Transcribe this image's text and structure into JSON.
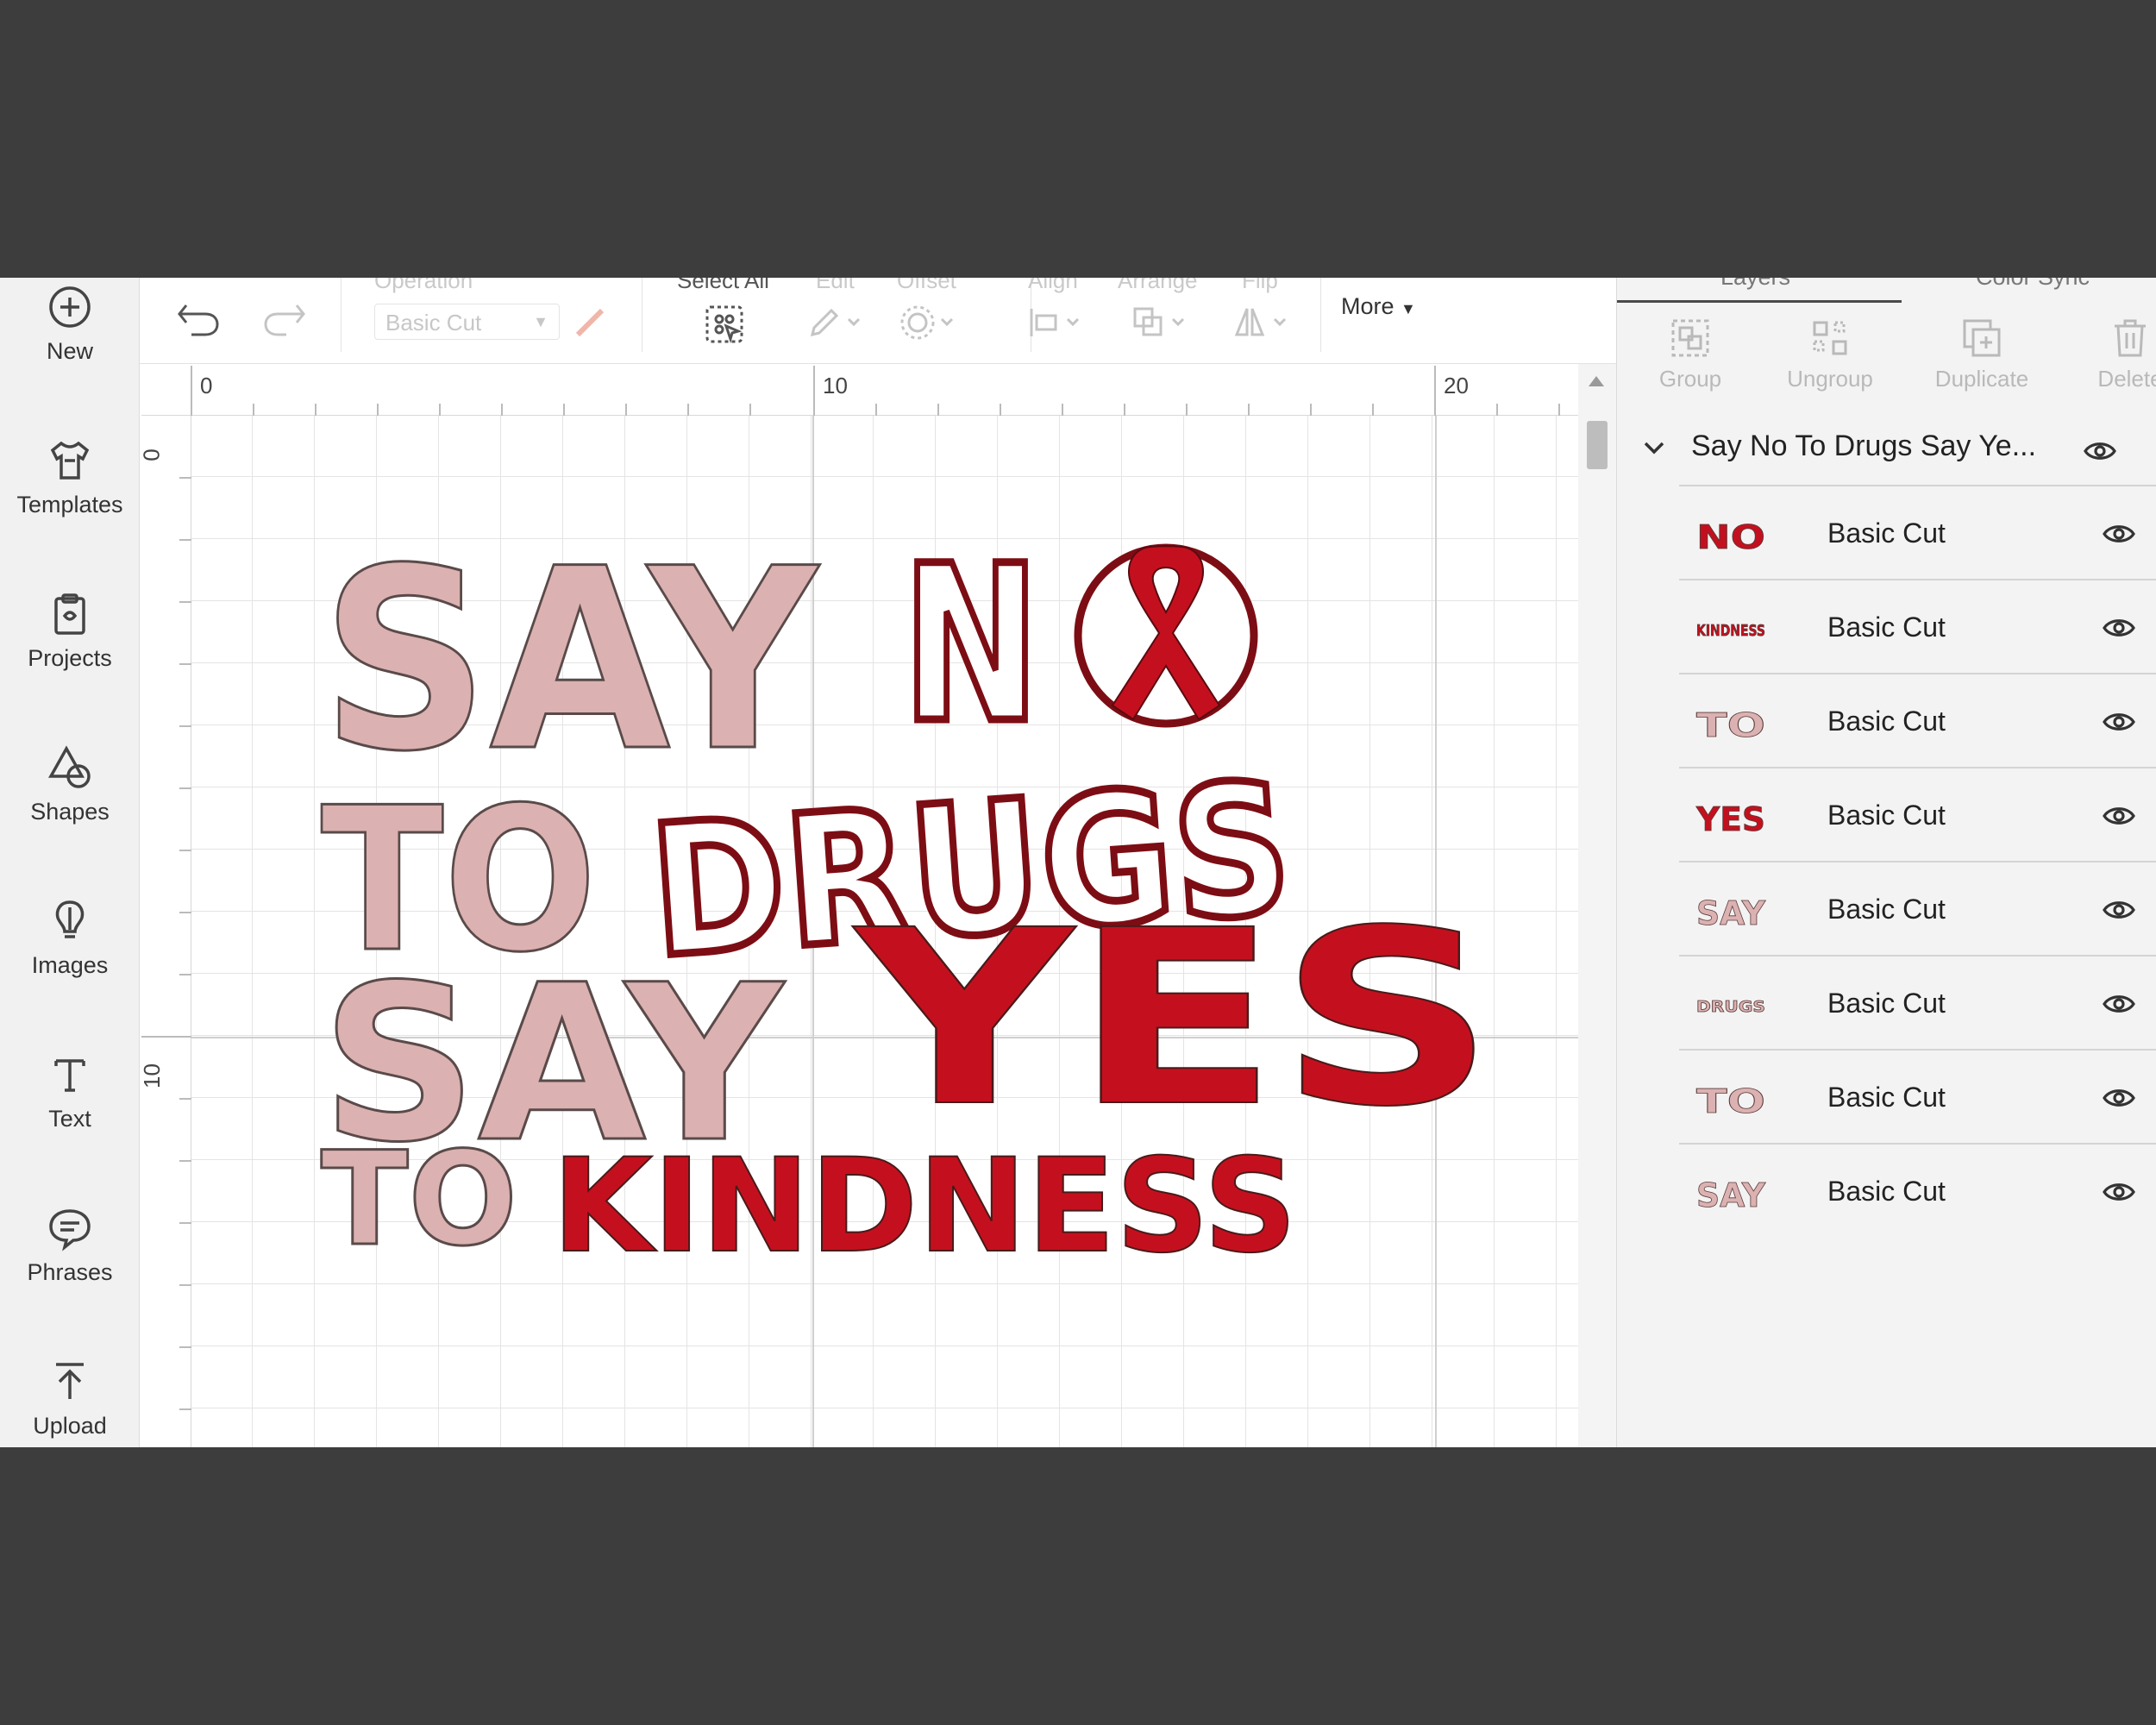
{
  "sidebar": {
    "items": [
      {
        "label": "New",
        "icon": "plus-circle-icon"
      },
      {
        "label": "Templates",
        "icon": "tshirt-icon"
      },
      {
        "label": "Projects",
        "icon": "clipboard-icon"
      },
      {
        "label": "Shapes",
        "icon": "shapes-icon"
      },
      {
        "label": "Images",
        "icon": "lightbulb-icon"
      },
      {
        "label": "Text",
        "icon": "text-icon"
      },
      {
        "label": "Phrases",
        "icon": "speech-bubble-icon"
      },
      {
        "label": "Upload",
        "icon": "upload-icon"
      }
    ]
  },
  "toolbar": {
    "operation_label": "Operation",
    "operation_value": "Basic Cut",
    "select_all_label": "Select All",
    "edit_label": "Edit",
    "offset_label": "Offset",
    "align_label": "Align",
    "arrange_label": "Arrange",
    "flip_label": "Flip",
    "more_label": "More"
  },
  "rulers": {
    "top": [
      "0",
      "10",
      "20"
    ],
    "left": [
      "0",
      "10"
    ]
  },
  "canvas": {
    "words": {
      "say1": "SAY",
      "no": "N",
      "to1": "TO",
      "drugs": "DRUGS",
      "say2": "SAY",
      "yes": "YES",
      "to2": "TO",
      "kindness": "KINDNESS"
    },
    "colors": {
      "pink": "#dbb2b1",
      "red": "#c4101e",
      "outline": "#7d0d14"
    }
  },
  "right_panel": {
    "tabs": [
      "Layers",
      "Color Sync"
    ],
    "actions": [
      {
        "label": "Group",
        "icon": "group-icon"
      },
      {
        "label": "Ungroup",
        "icon": "ungroup-icon"
      },
      {
        "label": "Duplicate",
        "icon": "duplicate-icon"
      },
      {
        "label": "Delete",
        "icon": "trash-icon"
      }
    ],
    "group_title": "Say No To Drugs Say Ye...",
    "layers": [
      {
        "thumb": "NO",
        "name": "Basic Cut",
        "color": "#c4101e"
      },
      {
        "thumb": "KINDNESS",
        "name": "Basic Cut",
        "color": "#c4101e"
      },
      {
        "thumb": "TO",
        "name": "Basic Cut",
        "color": "#dbb2b1"
      },
      {
        "thumb": "YES",
        "name": "Basic Cut",
        "color": "#c4101e"
      },
      {
        "thumb": "SAY",
        "name": "Basic Cut",
        "color": "#dbb2b1"
      },
      {
        "thumb": "DRUGS",
        "name": "Basic Cut",
        "color": "#dbb2b1"
      },
      {
        "thumb": "TO",
        "name": "Basic Cut",
        "color": "#dbb2b1"
      },
      {
        "thumb": "SAY",
        "name": "Basic Cut",
        "color": "#dbb2b1"
      }
    ]
  }
}
